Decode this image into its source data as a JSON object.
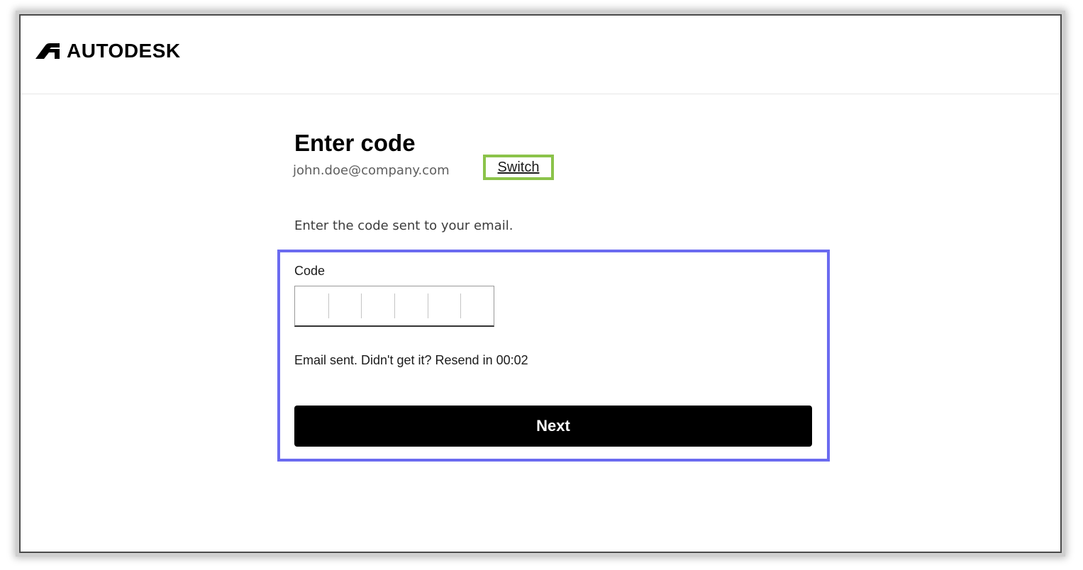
{
  "header": {
    "brand_name": "AUTODESK",
    "logo_icon": "autodesk-logo-icon"
  },
  "form": {
    "title": "Enter code",
    "email": "john.doe@company.com",
    "switch_label": "Switch",
    "instruction": "Enter the code sent to your email.",
    "code_label": "Code",
    "code_digits": [
      "",
      "",
      "",
      "",
      "",
      ""
    ],
    "resend_text": "Email sent. Didn't get it? Resend in 00:02",
    "next_label": "Next"
  },
  "annotations": {
    "switch_highlight_color": "#8bc34a",
    "code_section_highlight_color": "#6b6bf0"
  },
  "colors": {
    "button_bg": "#000000",
    "button_text": "#ffffff",
    "email_text": "#5f5f5f"
  }
}
